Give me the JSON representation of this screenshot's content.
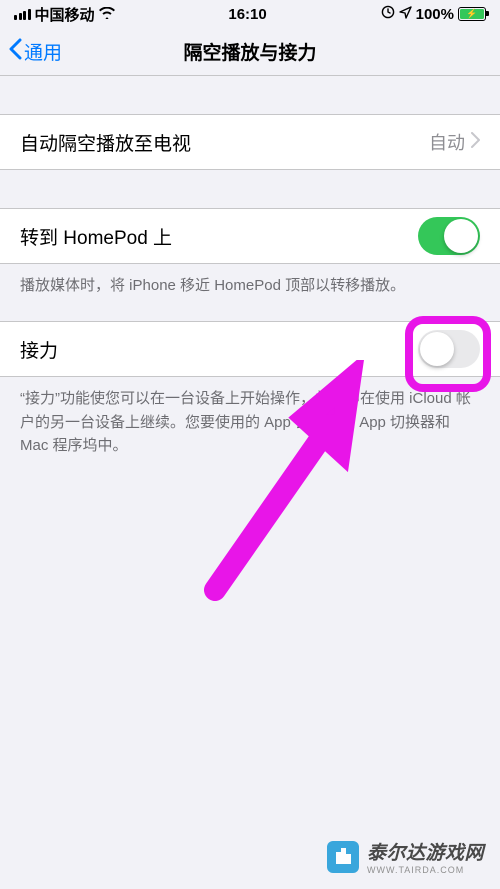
{
  "status": {
    "carrier": "中国移动",
    "time": "16:10",
    "battery": "100%"
  },
  "nav": {
    "back": "通用",
    "title": "隔空播放与接力"
  },
  "rows": {
    "airplay": {
      "label": "自动隔空播放至电视",
      "value": "自动"
    },
    "homepod": {
      "label": "转到 HomePod 上",
      "on": true
    },
    "handoff": {
      "label": "接力",
      "on": false
    }
  },
  "footers": {
    "homepod": "播放媒体时，将 iPhone 移近 HomePod 顶部以转移播放。",
    "handoff": "“接力”功能使您可以在一台设备上开始操作，并立即在使用 iCloud 帐户的另一台设备上继续。您要使用的 App 会显示在 App 切换器和 Mac 程序坞中。"
  },
  "watermark": {
    "text": "泰尔达游戏网",
    "sub": "WWW.TAIRDA.COM"
  }
}
